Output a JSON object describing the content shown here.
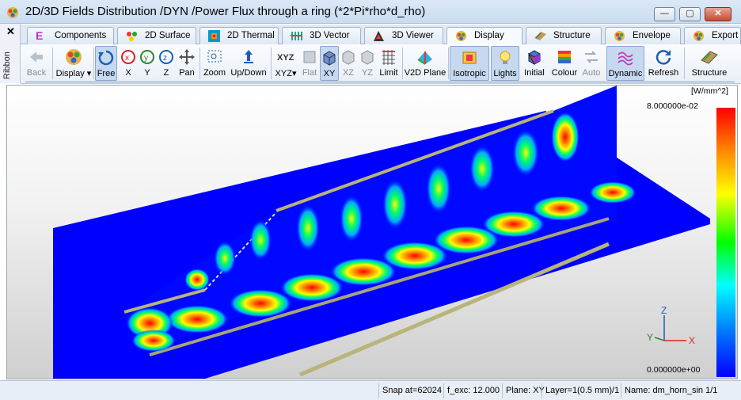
{
  "window": {
    "title": "2D/3D Fields Distribution /DYN /Power Flux through a ring (*2*Pi*rho*d_rho)",
    "minimize_label": "—",
    "maximize_label": "▢",
    "close_label": "✕"
  },
  "ribbon": {
    "close_label": "✕",
    "label": "Ribbon"
  },
  "tabs": [
    {
      "label": "Components",
      "icon": "components-e-icon"
    },
    {
      "label": "2D Surface",
      "icon": "surface-2d-icon"
    },
    {
      "label": "2D Thermal",
      "icon": "thermal-2d-icon"
    },
    {
      "label": "3D Vector",
      "icon": "vector-3d-icon"
    },
    {
      "label": "3D Viewer",
      "icon": "viewer-3d-icon"
    },
    {
      "label": "Display",
      "icon": "display-icon",
      "active": true
    },
    {
      "label": "Structure",
      "icon": "structure-icon"
    },
    {
      "label": "Envelope",
      "icon": "envelope-icon"
    },
    {
      "label": "Export",
      "icon": "export-icon"
    }
  ],
  "toolbar": {
    "back": "Back",
    "display": "Display",
    "free": "Free",
    "x": "X",
    "y": "Y",
    "z": "Z",
    "pan": "Pan",
    "zoom": "Zoom",
    "updown": "Up/Down",
    "xyz": "XYZ",
    "flat": "Flat",
    "xy": "XY",
    "xz": "XZ",
    "yz": "YZ",
    "limit": "Limit",
    "v2d_plane": "V2D Plane",
    "isotropic": "Isotropic",
    "lights": "Lights",
    "initial": "Initial",
    "colour": "Colour",
    "auto": "Auto",
    "dynamic": "Dynamic",
    "refresh": "Refresh",
    "structure": "Structure"
  },
  "viewport": {
    "units": "[W/mm^2]",
    "max_value": "8.000000e-02",
    "min_value": "0.000000e+00",
    "axes": {
      "x": "X",
      "y": "Y",
      "z": "Z"
    },
    "colors": {
      "field_bg": "#0000ff",
      "hot": "#ff0000",
      "mesh": "#b8b47a"
    }
  },
  "status": {
    "snap": "Snap at=62024",
    "fexc": "f_exc: 12.000",
    "plane": "Plane: XY",
    "layer": "Layer=1(0.5 mm)/1",
    "name": "Name: dm_horn_sin 1/1"
  }
}
